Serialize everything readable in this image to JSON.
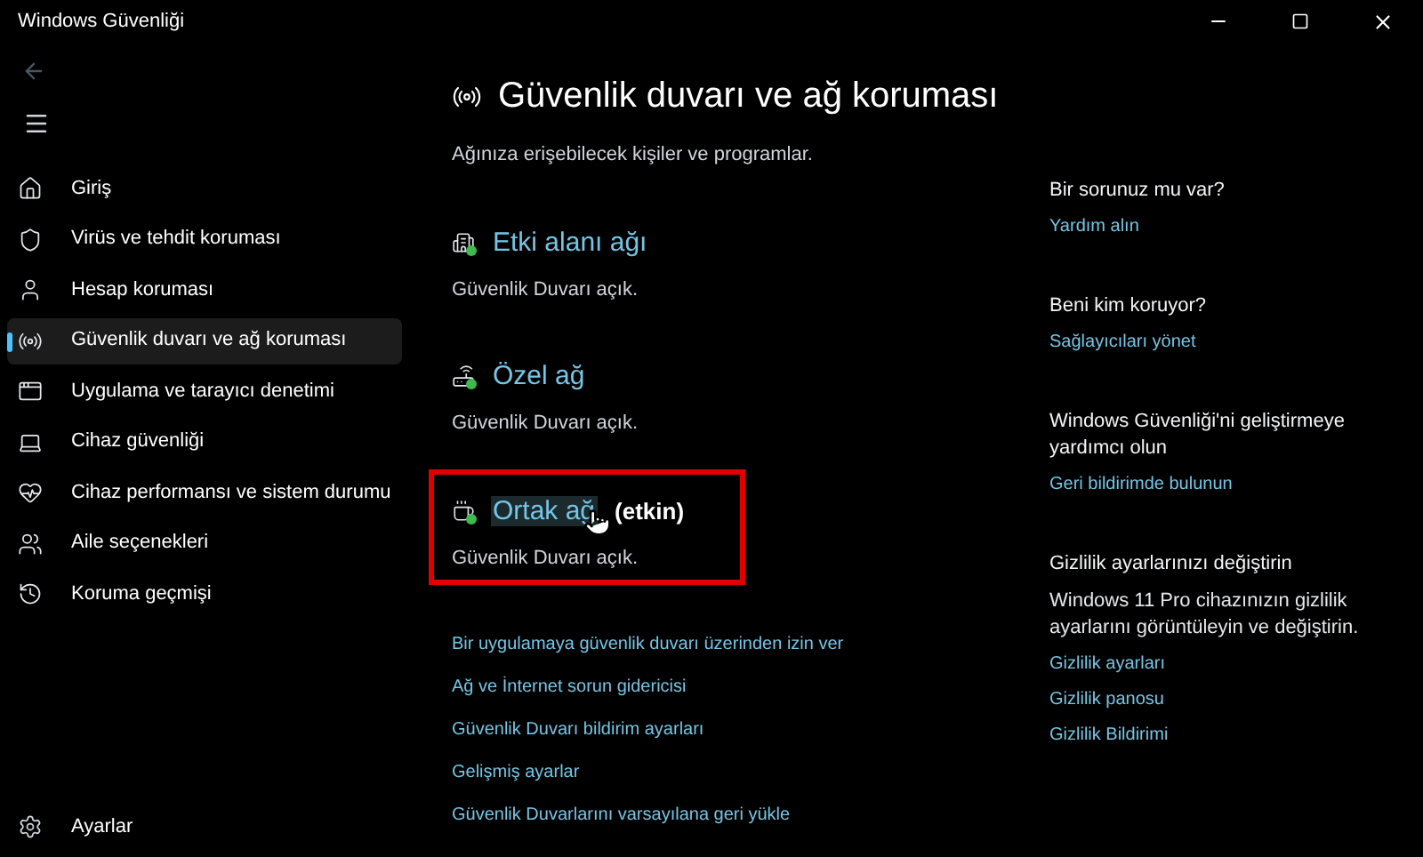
{
  "window": {
    "title": "Windows Güvenliği"
  },
  "sidebar": {
    "items": [
      {
        "kind": "home",
        "label": "Giriş",
        "selected": false
      },
      {
        "kind": "shield",
        "label": "Virüs ve tehdit koruması",
        "selected": false
      },
      {
        "kind": "person",
        "label": "Hesap koruması",
        "selected": false
      },
      {
        "kind": "antenna",
        "label": "Güvenlik duvarı ve ağ koruması",
        "selected": true
      },
      {
        "kind": "window",
        "label": "Uygulama ve tarayıcı denetimi",
        "selected": false
      },
      {
        "kind": "laptop",
        "label": "Cihaz güvenliği",
        "selected": false
      },
      {
        "kind": "heart",
        "label": "Cihaz performansı ve sistem durumu",
        "selected": false
      },
      {
        "kind": "family",
        "label": "Aile seçenekleri",
        "selected": false
      },
      {
        "kind": "history",
        "label": "Koruma geçmişi",
        "selected": false
      }
    ],
    "settings": "Ayarlar"
  },
  "page": {
    "title": "Güvenlik duvarı ve ağ koruması",
    "subtitle": "Ağınıza erişebilecek kişiler ve programlar.",
    "networks": [
      {
        "kind": "domain",
        "name": "Etki alanı ağı",
        "status": "Güvenlik Duvarı açık.",
        "highlighted": false
      },
      {
        "kind": "private",
        "name": "Özel ağ",
        "status": "Güvenlik Duvarı açık.",
        "highlighted": false
      },
      {
        "kind": "public",
        "name": "Ortak ağ",
        "active_label": "(etkin)",
        "status": "Güvenlik Duvarı açık.",
        "highlighted": true
      }
    ],
    "links": [
      "Bir uygulamaya güvenlik duvarı üzerinden izin ver",
      "Ağ ve İnternet sorun gidericisi",
      "Güvenlik Duvarı bildirim ayarları",
      "Gelişmiş ayarlar",
      "Güvenlik Duvarlarını varsayılana geri yükle"
    ]
  },
  "side_panel": [
    {
      "heading": "Bir sorunuz mu var?",
      "links": [
        "Yardım alın"
      ]
    },
    {
      "heading": "Beni kim koruyor?",
      "links": [
        "Sağlayıcıları yönet"
      ]
    },
    {
      "heading": "Windows Güvenliği'ni geliştirmeye yardımcı olun",
      "links": [
        "Geri bildirimde bulunun"
      ]
    },
    {
      "heading": "Gizlilik ayarlarınızı değiştirin",
      "text": "Windows 11 Pro cihazınızın gizlilik ayarlarını görüntüleyin ve değiştirin.",
      "links": [
        "Gizlilik ayarları",
        "Gizlilik panosu",
        "Gizlilik Bildirimi"
      ]
    }
  ]
}
